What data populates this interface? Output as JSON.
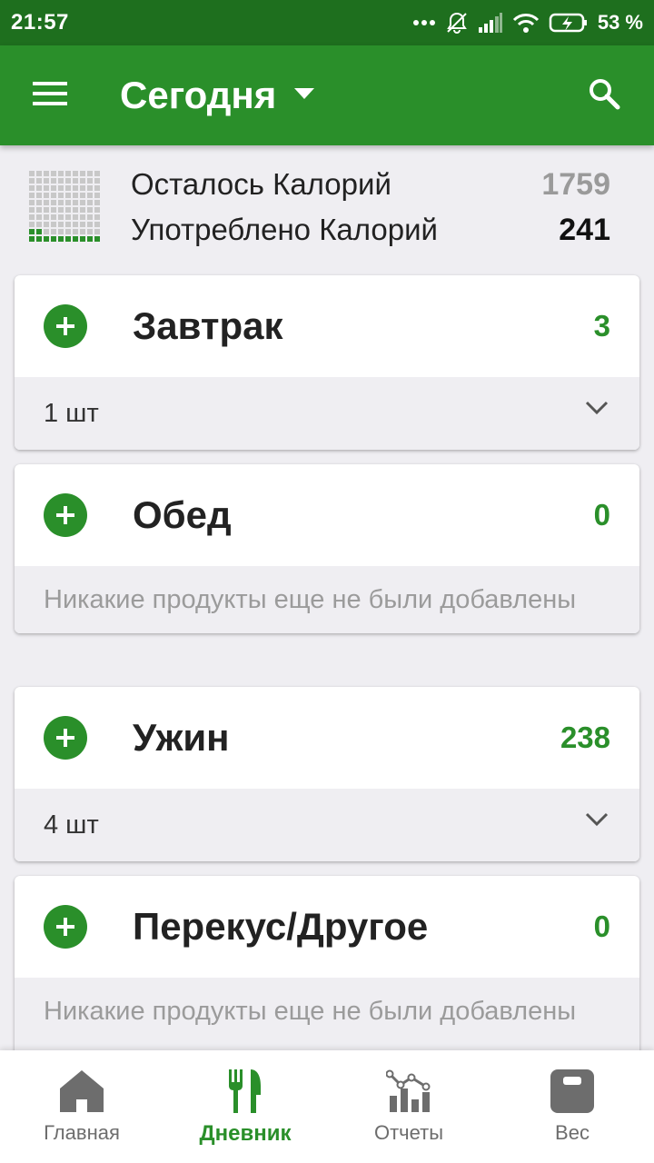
{
  "status": {
    "time": "21:57",
    "battery": "53 %"
  },
  "header": {
    "title": "Сегодня",
    "icons": [
      "menu-icon",
      "dropdown-arrow-icon",
      "search-icon"
    ]
  },
  "summary": {
    "remaining_label": "Осталось Калорий",
    "remaining_value": "1759",
    "consumed_label": "Употреблено Калорий",
    "consumed_value": "241",
    "consumed_fraction": 0.12
  },
  "meals": [
    {
      "name": "Завтрак",
      "calories": "3",
      "footer": "1 шт",
      "expandable": true
    },
    {
      "name": "Обед",
      "calories": "0",
      "footer": "Никакие продукты еще не были добавлены",
      "expandable": false
    },
    {
      "name": "Ужин",
      "calories": "238",
      "footer": "4 шт",
      "expandable": true
    },
    {
      "name": "Перекус/Другое",
      "calories": "0",
      "footer": "Никакие продукты еще не были добавлены",
      "expandable": false
    }
  ],
  "nav": {
    "items": [
      {
        "label": "Главная",
        "icon": "home-icon"
      },
      {
        "label": "Дневник",
        "icon": "fork-knife-icon"
      },
      {
        "label": "Отчеты",
        "icon": "chart-icon"
      },
      {
        "label": "Вес",
        "icon": "scale-icon"
      }
    ],
    "active": "Дневник"
  },
  "colors": {
    "primary": "#2a8f2a",
    "status_bar": "#1e6f1e",
    "background": "#efeef2"
  }
}
